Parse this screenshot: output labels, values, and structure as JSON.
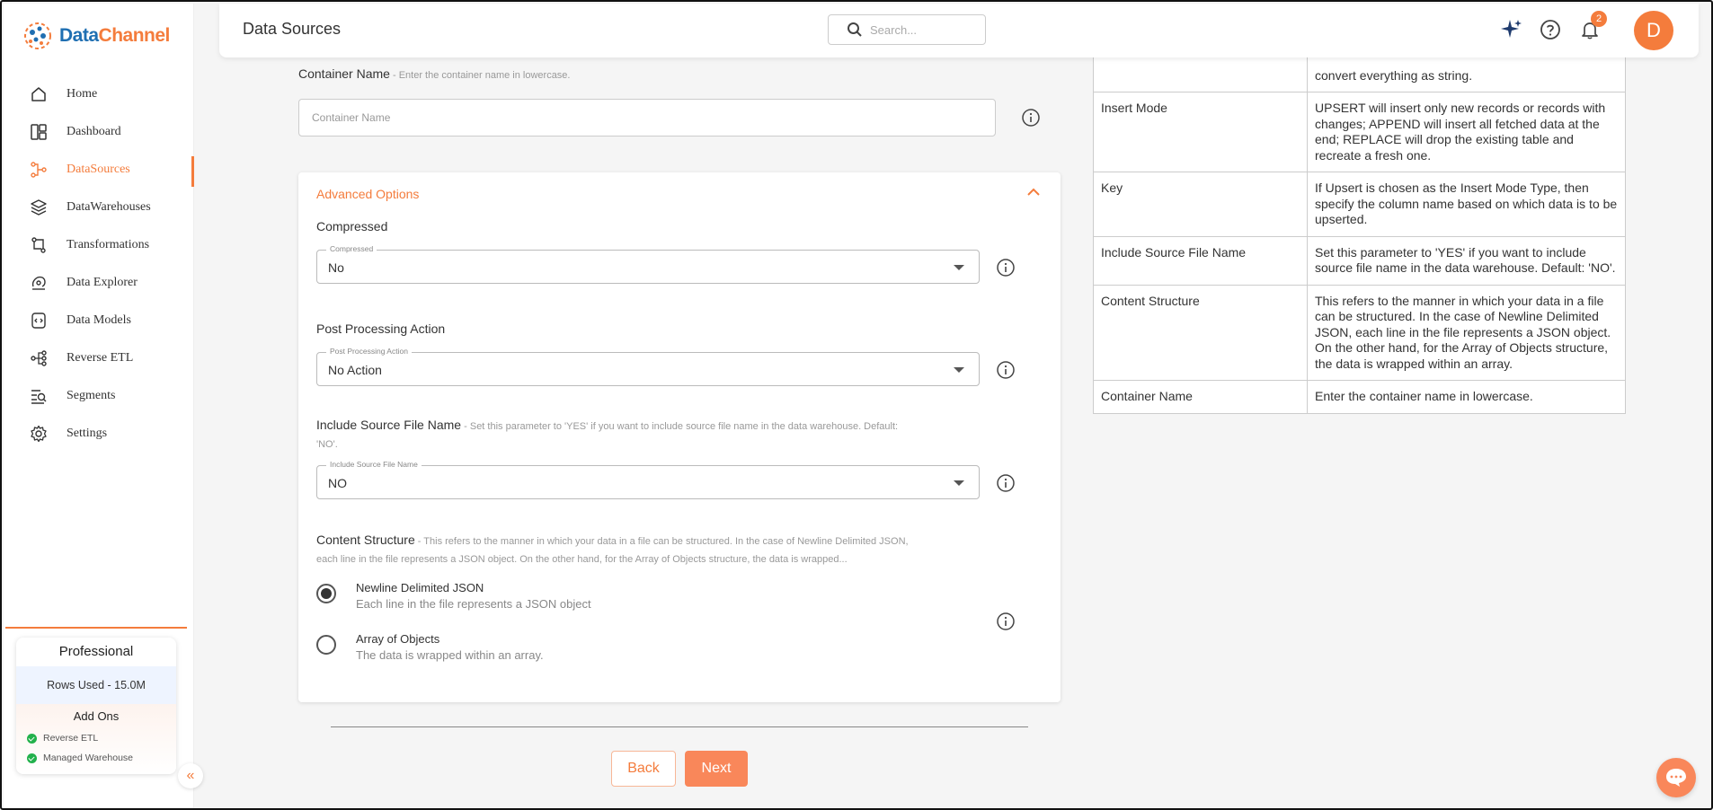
{
  "brand": {
    "name_part1": "Data",
    "name_part2": "Channel",
    "colors": {
      "accent": "#f47c3c",
      "blue": "#1f6fb2"
    }
  },
  "sidebar": {
    "items": [
      {
        "label": "Home",
        "icon": "home-icon"
      },
      {
        "label": "Dashboard",
        "icon": "dashboard-icon"
      },
      {
        "label": "DataSources",
        "icon": "datasources-icon",
        "active": true
      },
      {
        "label": "DataWarehouses",
        "icon": "layers-icon"
      },
      {
        "label": "Transformations",
        "icon": "transform-icon"
      },
      {
        "label": "Data Explorer",
        "icon": "explorer-icon"
      },
      {
        "label": "Data Models",
        "icon": "data-models-icon"
      },
      {
        "label": "Reverse ETL",
        "icon": "reverse-etl-icon"
      },
      {
        "label": "Segments",
        "icon": "segments-icon"
      },
      {
        "label": "Settings",
        "icon": "gear-icon"
      }
    ],
    "plan": {
      "name": "Professional",
      "rows_used": "Rows Used - 15.0M",
      "addons_title": "Add Ons",
      "addons": [
        "Reverse ETL",
        "Managed Warehouse"
      ]
    }
  },
  "header": {
    "title": "Data Sources",
    "search_placeholder": "Search...",
    "notification_count": "2",
    "avatar_letter": "D"
  },
  "form": {
    "container_name": {
      "label": "Container Name",
      "hint": " - Enter the container name in lowercase.",
      "placeholder": "Container Name",
      "value": ""
    },
    "advanced": {
      "title": "Advanced Options",
      "compressed": {
        "label": "Compressed",
        "floating": "Compressed",
        "value": "No"
      },
      "post_processing": {
        "label": "Post Processing Action",
        "floating": "Post Processing Action",
        "value": "No Action"
      },
      "include_source": {
        "label": "Include Source File Name",
        "hint": " - Set this parameter to 'YES' if you want to include source file name in the data warehouse. Default: 'NO'.",
        "floating": "Include Source File Name",
        "value": "NO"
      },
      "content_structure": {
        "label": "Content Structure",
        "hint": " - This refers to the manner in which your data in a file can be structured. In the case of Newline Delimited JSON, each line in the file represents a JSON object. On the other hand, for the Array of Objects structure, the data is wrapped...",
        "options": [
          {
            "title": "Newline Delimited JSON",
            "desc": "Each line in the file represents a JSON object",
            "selected": true
          },
          {
            "title": "Array of Objects",
            "desc": "The data is wrapped within an array.",
            "selected": false
          }
        ]
      }
    },
    "back_label": "Back",
    "next_label": "Next"
  },
  "help_table": {
    "rows": [
      {
        "param": "",
        "desc": "convert everything as string."
      },
      {
        "param": "Insert Mode",
        "desc": "UPSERT will insert only new records or records with changes; APPEND will insert all fetched data at the end; REPLACE will drop the existing table and recreate a fresh one."
      },
      {
        "param": "Key",
        "desc": "If Upsert is chosen as the Insert Mode Type, then specify the column name based on which data is to be upserted."
      },
      {
        "param": "Include Source File Name",
        "desc": "Set this parameter to 'YES' if you want to include source file name in the data warehouse. Default: 'NO'."
      },
      {
        "param": "Content Structure",
        "desc": "This refers to the manner in which your data in a file can be structured. In the case of Newline Delimited JSON, each line in the file represents a JSON object. On the other hand, for the Array of Objects structure, the data is wrapped within an array."
      },
      {
        "param": "Container Name",
        "desc": "Enter the container name in lowercase."
      }
    ]
  }
}
